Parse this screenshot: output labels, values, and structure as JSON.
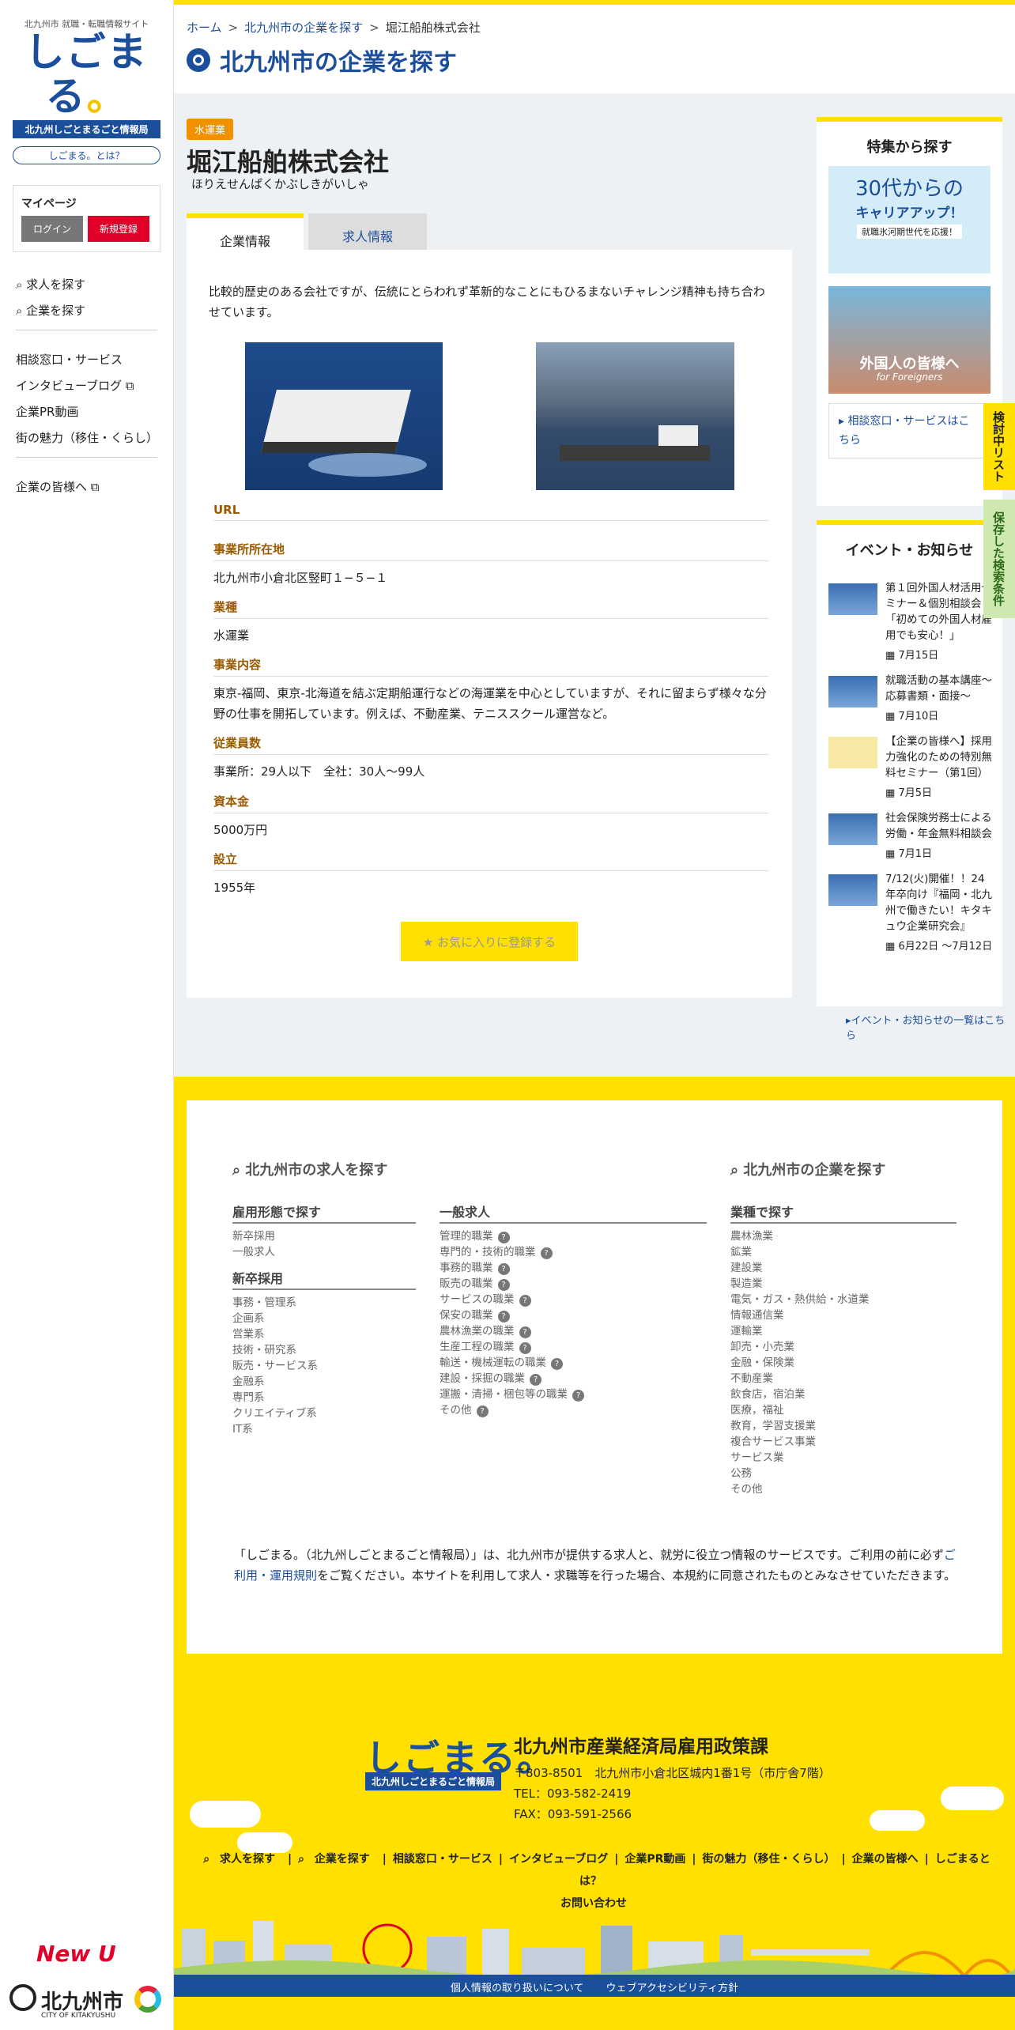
{
  "sidebar": {
    "logo_top": "北九州市 就職・転職情報サイト",
    "logo": "しごまる",
    "logo_band": "北九州しごとまるごと情報局",
    "what": "しごまる。とは？",
    "mypage": "マイページ",
    "login": "ログイン",
    "register": "新規登録",
    "nav1": [
      "求人を探す",
      "企業を探す"
    ],
    "nav2": [
      "相談窓口・サービス",
      "インタビューブログ",
      "企業PR動画",
      "街の魅力（移住・くらし）"
    ],
    "nav3": [
      "企業の皆様へ"
    ],
    "newu": "New U",
    "city": "北九州市",
    "city_en": "CITY OF KITAKYUSHU"
  },
  "header": {
    "crumbs": [
      "ホーム",
      "北九州市の企業を探す",
      "堀江船舶株式会社"
    ],
    "title": "北九州市の企業を探す"
  },
  "company": {
    "tag": "水運業",
    "name": "堀江船舶株式会社",
    "kana": "ほりえせんぱくかぶしきがいしゃ",
    "tabs": [
      "企業情報",
      "求人情報"
    ],
    "intro": "比較的歴史のある会社ですが、伝統にとらわれず革新的なことにもひるまないチャレンジ精神も持ち合わせています。",
    "fields": [
      {
        "label": "URL",
        "value": ""
      },
      {
        "label": "事業所所在地",
        "value": "北九州市小倉北区竪町１−５−１"
      },
      {
        "label": "業種",
        "value": "水運業"
      },
      {
        "label": "事業内容",
        "value": "東京-福岡、東京-北海道を結ぶ定期船運行などの海運業を中心としていますが、それに留まらず様々な分野の仕事を開拓しています。例えば、不動産業、テニススクール運営など。"
      },
      {
        "label": "従業員数",
        "value": "事業所：29人以下　全社：30人〜99人"
      },
      {
        "label": "資本金",
        "value": "5000万円"
      },
      {
        "label": "設立",
        "value": "1955年"
      }
    ],
    "fav": "お気に入りに登録する"
  },
  "right": {
    "feature_title": "特集から探す",
    "banner1_big": "30代からの",
    "banner1_sub": "キャリアアップ！",
    "banner1_s2": "就職氷河期世代を応援！",
    "banner2": "外国人の皆様へ",
    "banner2_en": "for Foreigners",
    "consult": "相談窓口・サービスはこちら",
    "events_title": "イベント・お知らせ",
    "events": [
      {
        "text": "第１回外国人材活用セミナー＆個別相談会「初めての外国人材雇用でも安心！」",
        "date": "7月15日"
      },
      {
        "text": "就職活動の基本講座〜応募書類・面接〜",
        "date": "7月10日"
      },
      {
        "text": "【企業の皆様へ】採用力強化のための特別無料セミナー（第1回）",
        "date": "7月5日"
      },
      {
        "text": "社会保険労務士による労働・年金無料相談会",
        "date": "7月1日"
      },
      {
        "text": "7/12(火)開催！！24年卒向け『福岡・北九州で働きたい！キタキュウ企業研究会』",
        "date": "6月22日 〜7月12日"
      }
    ],
    "more": "イベント・お知らせの一覧はこちら",
    "tab_list": "検討中リスト",
    "tab_saved": "保存した検索条件"
  },
  "footer": {
    "search_jobs": "北九州市の求人を探す",
    "search_companies": "北九州市の企業を探す",
    "emp_title": "雇用形態で探す",
    "emp": [
      "新卒採用",
      "一般求人"
    ],
    "new_title": "新卒採用",
    "new": [
      "事務・管理系",
      "企画系",
      "営業系",
      "技術・研究系",
      "販売・サービス系",
      "金融系",
      "専門系",
      "クリエイティブ系",
      "IT系"
    ],
    "gen_title": "一般求人",
    "gen": [
      "管理的職業",
      "専門的・技術的職業",
      "事務的職業",
      "販売の職業",
      "サービスの職業",
      "保安の職業",
      "農林漁業の職業",
      "生産工程の職業",
      "輸送・機械運転の職業",
      "建設・採掘の職業",
      "運搬・清掃・梱包等の職業",
      "その他"
    ],
    "ind_title": "業種で探す",
    "ind": [
      "農林漁業",
      "鉱業",
      "建設業",
      "製造業",
      "電気・ガス・熱供給・水道業",
      "情報通信業",
      "運輸業",
      "卸売・小売業",
      "金融・保険業",
      "不動産業",
      "飲食店，宿泊業",
      "医療，福祉",
      "教育，学習支援業",
      "複合サービス事業",
      "サービス業",
      "公務",
      "その他"
    ],
    "disclaimer_a": "「しごまる。（北九州しごとまるごと情報局）」は、北九州市が提供する求人と、就労に役立つ情報のサービスです。ご利用の前に必ず",
    "disclaimer_link": "ご利用・運用規則",
    "disclaimer_b": "をご覧ください。本サイトを利用して求人・求職等を行った場合、本規約に同意されたものとみなさせていただきます。",
    "dept": "北九州市産業経済局雇用政策課",
    "addr": "〒803-8501　北九州市小倉北区城内1番1号（市庁舎7階）",
    "tel": "TEL：093-582-2419",
    "fax": "FAX：093-591-2566",
    "nav": [
      "求人を探す",
      "企業を探す",
      "相談窓口・サービス",
      "インタビューブログ",
      "企業PR動画",
      "街の魅力（移住・くらし）",
      "企業の皆様へ",
      "しごまるとは？",
      "お問い合わせ"
    ],
    "bottom": [
      "個人情報の取り扱いについて",
      "ウェブアクセシビリティ方針"
    ]
  },
  "colors": {
    "yellow": "#ffe000",
    "blue": "#1b4e9b",
    "orange": "#f29100",
    "red": "#e0002a"
  }
}
